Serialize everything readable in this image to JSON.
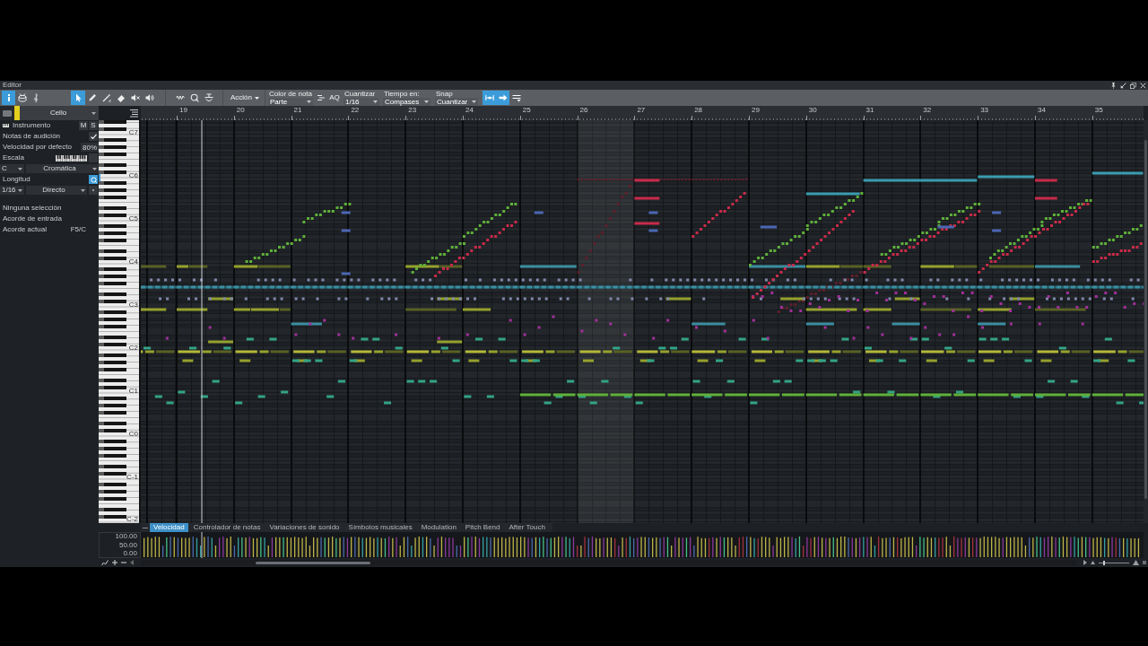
{
  "window": {
    "title": "Editor"
  },
  "toolbar": {
    "view_buttons": [
      {
        "kind": "inspector",
        "selected": true
      },
      {
        "kind": "drum",
        "selected": false
      },
      {
        "kind": "score",
        "selected": false
      }
    ],
    "tools": [
      {
        "kind": "arrow",
        "selected": true
      },
      {
        "kind": "pencil",
        "selected": false
      },
      {
        "kind": "line",
        "selected": false
      },
      {
        "kind": "eraser",
        "selected": false
      },
      {
        "kind": "mute",
        "selected": false
      },
      {
        "kind": "listen",
        "selected": false
      }
    ],
    "action_menu": "Acción",
    "note_color": {
      "label": "Color de nota",
      "value": "Parte"
    },
    "auto_quantize": "AQ",
    "quantize": {
      "label": "Cuantizar",
      "value": "1/16"
    },
    "timebase": {
      "label": "Tiempo en:",
      "value": "Compases"
    },
    "snap": {
      "label": "Snap",
      "value": "Cuantizar"
    },
    "snap_buttons": [
      {
        "kind": "snap",
        "selected": true
      },
      {
        "kind": "forward",
        "selected": true
      },
      {
        "kind": "options",
        "selected": false
      }
    ]
  },
  "inspector": {
    "part": "Cello",
    "instrument": {
      "label": "Instrumento",
      "mute": "M",
      "solo": "S"
    },
    "audition": {
      "label": "Notas de audición",
      "checked": true
    },
    "default_velocity": {
      "label": "Velocidad por defecto",
      "value": "80%"
    },
    "scale": {
      "label": "Escala",
      "root": "C",
      "type": "Cromática"
    },
    "length": {
      "label": "Longitud",
      "quantize_on": true,
      "value": "1/16",
      "mode": "Directo"
    },
    "selection": "Ninguna selección",
    "input_chord": "Acorde de entrada",
    "current_chord": {
      "label": "Acorde actual",
      "value": "F5/C"
    }
  },
  "ruler": {
    "bars": [
      "19",
      "20",
      "21",
      "22",
      "23",
      "24",
      "25",
      "26",
      "27",
      "28",
      "29",
      "30",
      "31",
      "32",
      "33",
      "34",
      "35"
    ]
  },
  "keyboard": {
    "octave_labels": [
      "C7",
      "C6",
      "C5",
      "C4",
      "C3",
      "C2",
      "C1",
      "C0",
      "C-1",
      "C-2"
    ]
  },
  "lane_tabs": [
    {
      "label": "Velocidad",
      "selected": true
    },
    {
      "label": "Controlador de notas",
      "selected": false
    },
    {
      "label": "Variaciones de sonido",
      "selected": false
    },
    {
      "label": "Símbolos musicales",
      "selected": false
    },
    {
      "label": "Modulation",
      "selected": false
    },
    {
      "label": "Pitch Bend",
      "selected": false
    },
    {
      "label": "After Touch",
      "selected": false
    }
  ],
  "velocity_scale": [
    "100.00",
    "50.00",
    "0.00"
  ],
  "zoom_slider": {
    "level": 0.15
  }
}
